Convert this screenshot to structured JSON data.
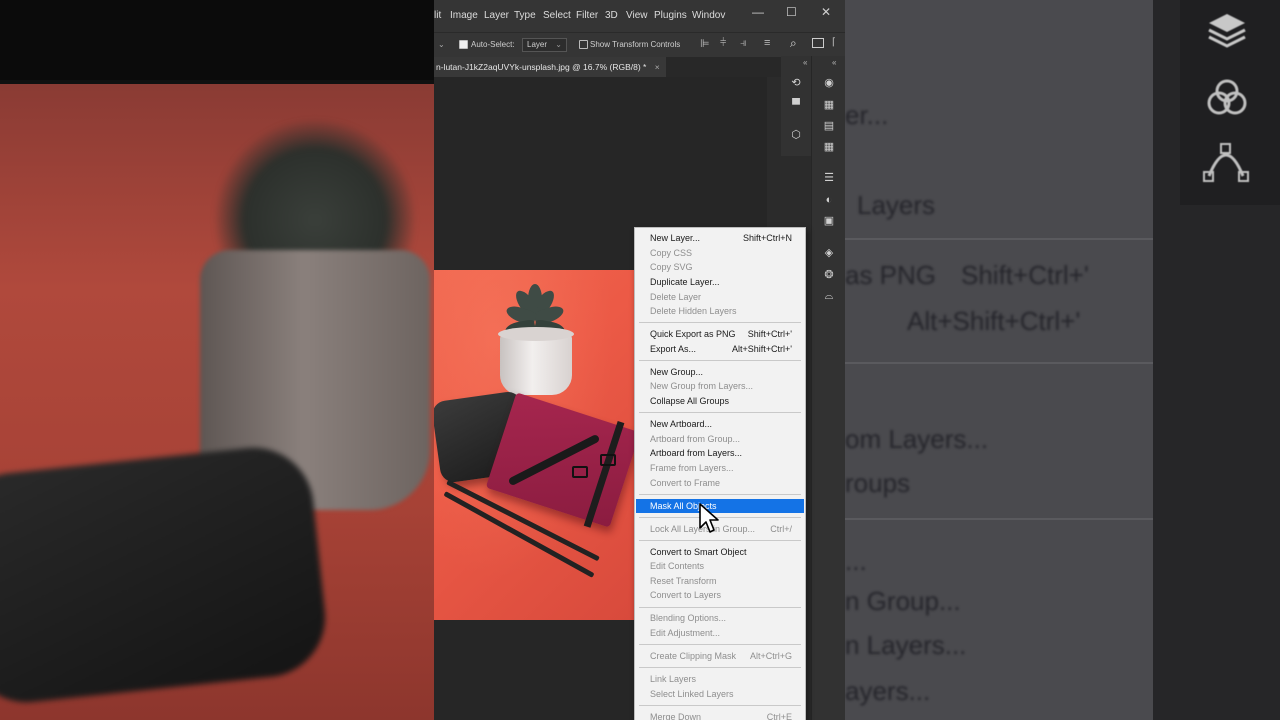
{
  "menubar": {
    "items": [
      "lit",
      "Image",
      "Layer",
      "Type",
      "Select",
      "Filter",
      "3D",
      "View",
      "Plugins",
      "Windov"
    ]
  },
  "window_controls": {
    "minimize": "—",
    "maximize": "☐",
    "close": "✕"
  },
  "options_bar": {
    "auto_select_label": "Auto-Select:",
    "auto_select_checked": true,
    "layer_select_value": "Layer",
    "show_transform_label": "Show Transform Controls",
    "show_transform_checked": false
  },
  "document_tab": {
    "title": "n-lutan-J1kZ2aqUVYk-unsplash.jpg @ 16.7% (RGB/8) *",
    "close": "×"
  },
  "context_menu": {
    "groups": [
      [
        {
          "label": "New Layer...",
          "shortcut": "Shift+Ctrl+N",
          "enabled": true
        },
        {
          "label": "Copy CSS",
          "shortcut": "",
          "enabled": false
        },
        {
          "label": "Copy SVG",
          "shortcut": "",
          "enabled": false
        },
        {
          "label": "Duplicate Layer...",
          "shortcut": "",
          "enabled": true
        },
        {
          "label": "Delete Layer",
          "shortcut": "",
          "enabled": false
        },
        {
          "label": "Delete Hidden Layers",
          "shortcut": "",
          "enabled": false
        }
      ],
      [
        {
          "label": "Quick Export as PNG",
          "shortcut": "Shift+Ctrl+'",
          "enabled": true
        },
        {
          "label": "Export As...",
          "shortcut": "Alt+Shift+Ctrl+'",
          "enabled": true
        }
      ],
      [
        {
          "label": "New Group...",
          "shortcut": "",
          "enabled": true
        },
        {
          "label": "New Group from Layers...",
          "shortcut": "",
          "enabled": false
        },
        {
          "label": "Collapse All Groups",
          "shortcut": "",
          "enabled": true
        }
      ],
      [
        {
          "label": "New Artboard...",
          "shortcut": "",
          "enabled": true
        },
        {
          "label": "Artboard from Group...",
          "shortcut": "",
          "enabled": false
        },
        {
          "label": "Artboard from Layers...",
          "shortcut": "",
          "enabled": true
        },
        {
          "label": "Frame from Layers...",
          "shortcut": "",
          "enabled": false
        },
        {
          "label": "Convert to Frame",
          "shortcut": "",
          "enabled": false
        }
      ],
      [
        {
          "label": "Mask All Objects",
          "shortcut": "",
          "enabled": true,
          "highlighted": true
        }
      ],
      [
        {
          "label": "Lock All Layers in Group...",
          "shortcut": "Ctrl+/",
          "enabled": false
        }
      ],
      [
        {
          "label": "Convert to Smart Object",
          "shortcut": "",
          "enabled": true
        },
        {
          "label": "Edit Contents",
          "shortcut": "",
          "enabled": false
        },
        {
          "label": "Reset Transform",
          "shortcut": "",
          "enabled": false
        },
        {
          "label": "Convert to Layers",
          "shortcut": "",
          "enabled": false
        }
      ],
      [
        {
          "label": "Blending Options...",
          "shortcut": "",
          "enabled": false
        },
        {
          "label": "Edit Adjustment...",
          "shortcut": "",
          "enabled": false
        }
      ],
      [
        {
          "label": "Create Clipping Mask",
          "shortcut": "Alt+Ctrl+G",
          "enabled": false
        }
      ],
      [
        {
          "label": "Link Layers",
          "shortcut": "",
          "enabled": false
        },
        {
          "label": "Select Linked Layers",
          "shortcut": "",
          "enabled": false
        }
      ],
      [
        {
          "label": "Merge Down",
          "shortcut": "Ctrl+E",
          "enabled": false
        }
      ]
    ]
  },
  "background_zoom_text": [
    {
      "text": "er..."
    },
    {
      "text": "Layers"
    },
    {
      "text": "as PNG"
    },
    {
      "text": "Shift+Ctrl+'"
    },
    {
      "text": "Alt+Shift+Ctrl+'"
    },
    {
      "text": "om Layers..."
    },
    {
      "text": "roups"
    },
    {
      "text": "..."
    },
    {
      "text": "n Group..."
    },
    {
      "text": "n Layers..."
    },
    {
      "text": "ayers..."
    }
  ],
  "colors": {
    "highlight": "#1473e6",
    "menu_bg": "#f2f2f2",
    "ps_chrome": "#353535"
  },
  "icons": {
    "right_panel": [
      "cube-3d-icon",
      "grid-icon",
      "gradient-icon",
      "table-icon",
      "sliders-icon",
      "adjust-icon",
      "layers-panel-icon",
      "layers-icon",
      "channels-icon",
      "paths-icon"
    ],
    "mid_panel": [
      "history-icon",
      "comment-icon",
      "cube-icon"
    ]
  }
}
